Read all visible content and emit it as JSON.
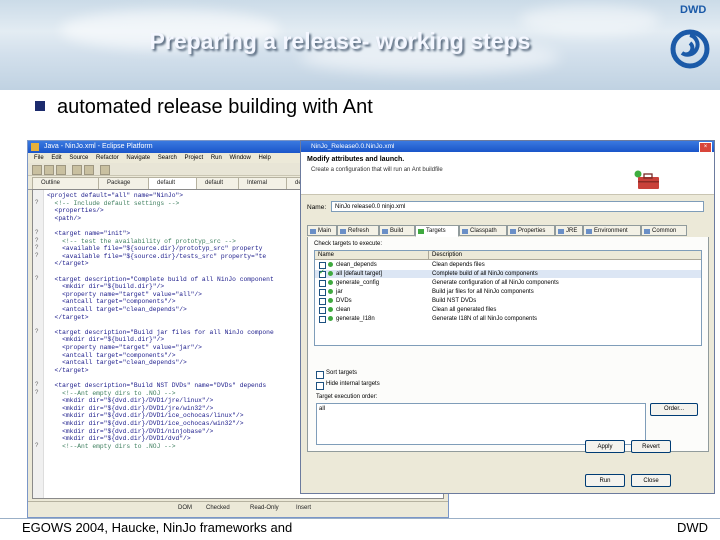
{
  "slide": {
    "title": "Preparing a release- working steps",
    "bullet": "automated release building with Ant",
    "logo_text": "DWD",
    "footer_left": "EGOWS 2004, Haucke, NinJo frameworks and",
    "footer_right": "DWD"
  },
  "colors": {
    "title_text": "#f4f7ff",
    "bullet_square": "#1c2b6d",
    "xp_titlebar": "#1a55c9",
    "code_keyword": "#1a1a8a",
    "code_comment": "#3f7f5f",
    "target_dot": "#3fa93f"
  },
  "eclipse": {
    "title": "Java - NinJo.xml - Eclipse Platform",
    "menus": [
      "File",
      "Edit",
      "Source",
      "Refactor",
      "Navigate",
      "Search",
      "Project",
      "Run",
      "Window",
      "Help"
    ],
    "tabs": [
      "Outline",
      "Package",
      "default",
      "default",
      "Internal",
      "default"
    ],
    "code_lines": [
      "<project default=\"all\" name=\"NinJo\">",
      "  <!-- Include default settings -->",
      "  <properties/>",
      "  <path/>",
      "",
      "  <target name=\"init\">",
      "    <!-- test the availability of prototyp_src -->",
      "    <available file=\"${source.dir}/prototyp_src\" property",
      "    <available file=\"${source.dir}/tests_src\" property=\"te",
      "  </target>",
      "",
      "  <target description=\"Complete build of all NinJo component",
      "    <mkdir dir=\"${build.dir}\"/>",
      "    <property name=\"target\" value=\"all\"/>",
      "    <antcall target=\"components\"/>",
      "    <antcall target=\"clean_depends\"/>",
      "  </target>",
      "",
      "  <target description=\"Build jar files for all NinJo compone",
      "    <mkdir dir=\"${build.dir}\"/>",
      "    <property name=\"target\" value=\"jar\"/>",
      "    <antcall target=\"components\"/>",
      "    <antcall target=\"clean_depends\"/>",
      "  </target>",
      "",
      "  <target description=\"Build NST DVDs\" name=\"DVDs\" depends",
      "    <!--Ant empty dirs to .NOJ -->",
      "    <mkdir dir=\"${dvd.dir}/DVD1/jre/linux\"/>",
      "    <mkdir dir=\"${dvd.dir}/DVD1/jre/win32\"/>",
      "    <mkdir dir=\"${dvd.dir}/DVD1/ice_ochocas/linux\"/>",
      "    <mkdir dir=\"${dvd.dir}/DVD1/ice_ochocas/win32\"/>",
      "    <mkdir dir=\"${dvd.dir}/DVD1/ninjobase\"/>",
      "    <mkdir dir=\"${dvd.dir}/DVD1/dvd\"/>",
      "    <!--Ant empty dirs to .NOJ -->"
    ],
    "status": [
      "DOM",
      "Checked",
      "Read-Only",
      "Insert"
    ]
  },
  "dialog": {
    "title": "NinJo_Release0.0.NinJo.xml",
    "heading": "Modify attributes and launch.",
    "subheading": "Create a configuration that will run an Ant buildfile",
    "name_label": "Name:",
    "name_value": "NinJo release0.0 ninjo.xml",
    "tabs": [
      "Main",
      "Refresh",
      "Build",
      "Targets",
      "Classpath",
      "JRE",
      "Properties",
      "Environment",
      "Common"
    ],
    "active_tab": "Targets",
    "check_targets_label": "Check targets to execute:",
    "table_headers": [
      "Name",
      "Description"
    ],
    "targets": [
      {
        "name": "clean_depends",
        "desc": "Clean depends files",
        "checked": false
      },
      {
        "name": "all [default target]",
        "desc": "Complete build of all NinJo components",
        "checked": true
      },
      {
        "name": "generate_config",
        "desc": "Generate configuration of all NinJo components",
        "checked": false
      },
      {
        "name": "jar",
        "desc": "Build jar files for all NinJo components",
        "checked": false
      },
      {
        "name": "DVDs",
        "desc": "Build NST DVDs",
        "checked": false
      },
      {
        "name": "clean",
        "desc": "Clean all generated files",
        "checked": false
      },
      {
        "name": "generate_I18n",
        "desc": "Generate I18N of all NinJo components",
        "checked": false
      }
    ],
    "sort_label": "Sort targets",
    "hide_label": "Hide internal targets",
    "order_label": "Target execution order:",
    "order_value": "all",
    "order_button": "Order...",
    "apply_label": "Apply",
    "revert_label": "Revert",
    "run_label": "Run",
    "close_label": "Close"
  }
}
